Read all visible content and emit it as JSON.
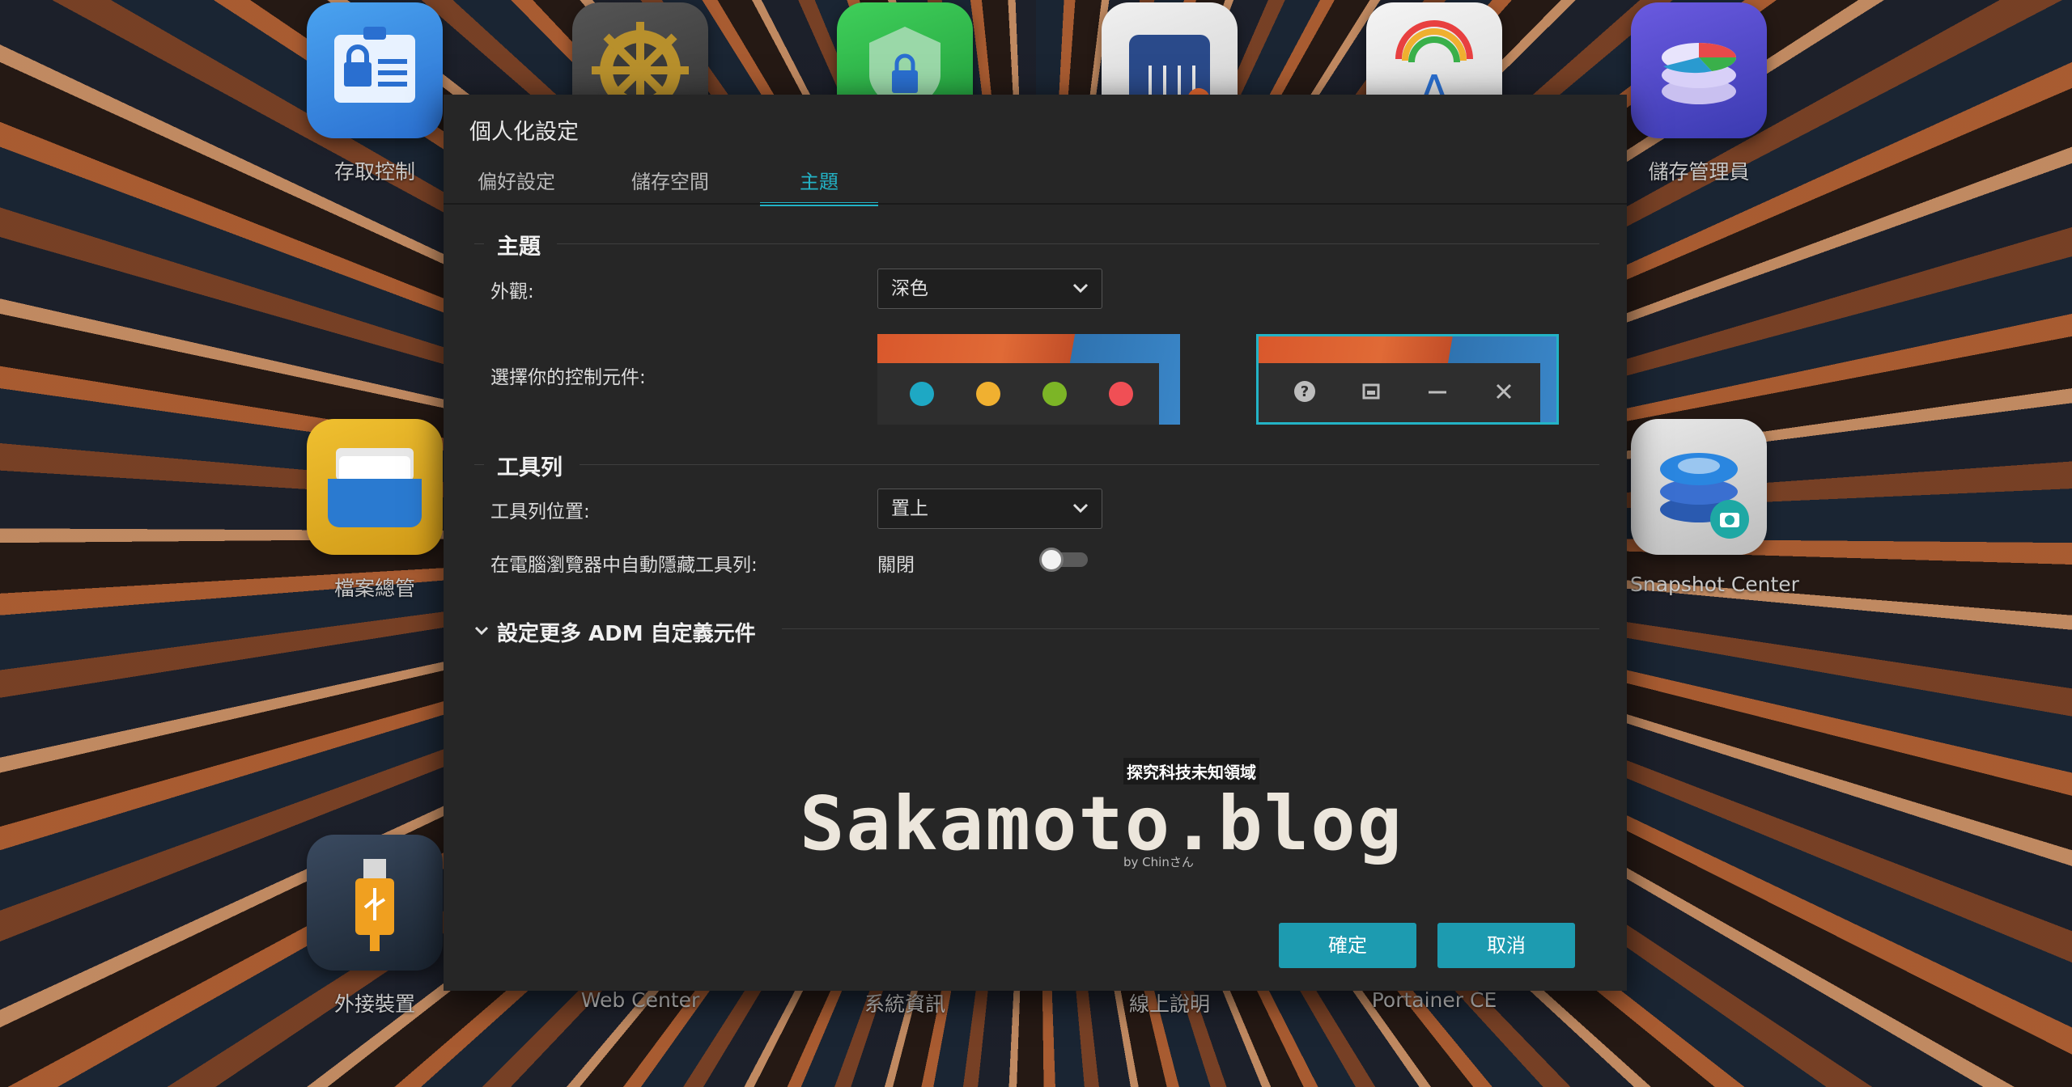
{
  "desktop": {
    "apps": [
      {
        "label": "存取控制",
        "icon": "access-control-icon"
      },
      {
        "label": "",
        "icon": "gear-icon"
      },
      {
        "label": "",
        "icon": "security-shield-icon"
      },
      {
        "label": "",
        "icon": "app-central-icon"
      },
      {
        "label": "",
        "icon": "font-app-icon"
      },
      {
        "label": "儲存管理員",
        "icon": "storage-manager-icon"
      },
      {
        "label": "檔案總管",
        "icon": "file-explorer-icon"
      },
      {
        "label": "Snapshot Center",
        "icon": "snapshot-center-icon"
      },
      {
        "label": "外接裝置",
        "icon": "external-devices-icon"
      },
      {
        "label": "Web Center",
        "icon": ""
      },
      {
        "label": "系統資訊",
        "icon": ""
      },
      {
        "label": "線上說明",
        "icon": ""
      },
      {
        "label": "Portainer CE",
        "icon": ""
      }
    ]
  },
  "dialog": {
    "title": "個人化設定",
    "tabs": [
      {
        "label": "偏好設定",
        "active": false
      },
      {
        "label": "儲存空間",
        "active": false
      },
      {
        "label": "主題",
        "active": true
      }
    ],
    "theme_section": {
      "title": "主題",
      "appearance_label": "外觀:",
      "appearance_value": "深色",
      "controls_label": "選擇你的控制元件:"
    },
    "toolbar_section": {
      "title": "工具列",
      "position_label": "工具列位置:",
      "position_value": "置上",
      "autohide_label": "在電腦瀏覽器中自動隱藏工具列:",
      "autohide_value": "關閉"
    },
    "more_widgets": "設定更多 ADM 自定義元件",
    "buttons": {
      "confirm": "確定",
      "cancel": "取消"
    }
  },
  "watermark": {
    "main": "Sakamoto.blog",
    "tag": "探究科技未知領域",
    "by": "by Chinさん"
  },
  "colors": {
    "accent": "#23b3c6",
    "button": "#1d9bb0",
    "dialog_bg": "#262626",
    "dot_teal": "#1ea8c4",
    "dot_yellow": "#f0b030",
    "dot_green": "#7cb526",
    "dot_red": "#f04f55"
  }
}
